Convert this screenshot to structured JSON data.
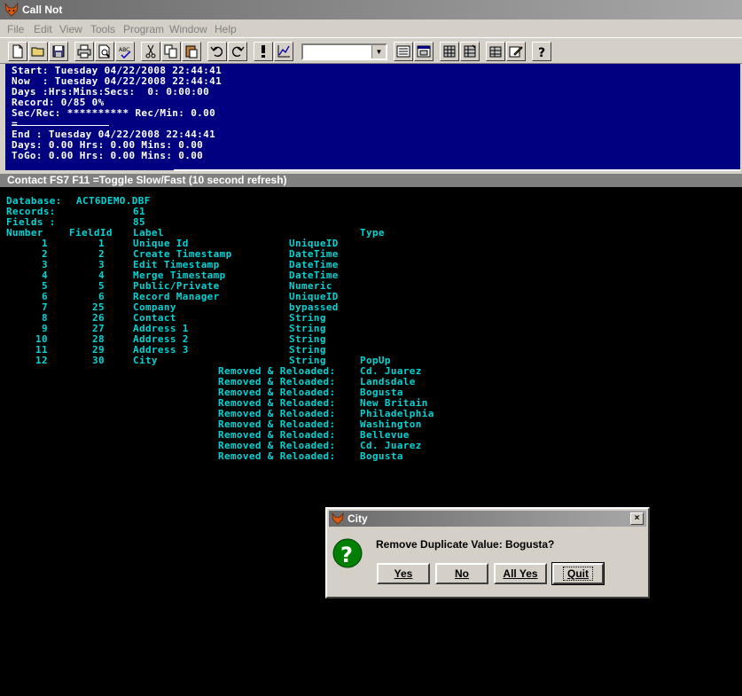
{
  "window": {
    "title": "Call Not"
  },
  "menu": [
    "File",
    "Edit",
    "View",
    "Tools",
    "Program",
    "Window",
    "Help"
  ],
  "toolbar": {
    "left_icons": [
      "new-file-icon",
      "open-folder-icon",
      "save-icon",
      "print-icon",
      "print-preview-icon",
      "spellcheck-icon",
      "cut-icon",
      "copy-icon",
      "paste-icon",
      "undo-icon",
      "redo-icon",
      "exclamation-icon",
      "chart-icon"
    ],
    "combo_value": "",
    "right_icons": [
      "form-icon",
      "window-icon",
      "grid-a-icon",
      "grid-b-icon",
      "grid-c-icon",
      "edit-note-icon",
      "help-icon"
    ]
  },
  "status_panel": {
    "lines": [
      "Start: Tuesday 04/22/2008 22:44:41",
      "Now  : Tuesday 04/22/2008 22:44:41",
      "Days :Hrs:Mins:Secs:  0: 0:00:00",
      "Record: 0/85 0%",
      "Sec/Rec: ********** Rec/Min: 0.00",
      "=",
      "End : Tuesday 04/22/2008 22:44:41",
      "Days: 0.00 Hrs: 0.00 Mins: 0.00",
      "ToGo: 0.00 Hrs: 0.00 Mins: 0.00"
    ]
  },
  "strip": {
    "text": "Contact FS7  F11 =Toggle Slow/Fast (10 second refresh)"
  },
  "console": {
    "database_label": "Database:",
    "database_value": "ACT6DEMO.DBF",
    "records_label": "Records:",
    "records_value": "61",
    "fields_label": "Fields :",
    "fields_value": "85",
    "headers": {
      "number": "Number",
      "fieldid": "FieldId",
      "label": "Label",
      "type": "Type"
    },
    "rows": [
      {
        "number": "1",
        "fieldid": "1",
        "label": "Unique Id",
        "type": "UniqueID",
        "extra": ""
      },
      {
        "number": "2",
        "fieldid": "2",
        "label": "Create Timestamp",
        "type": "DateTime",
        "extra": ""
      },
      {
        "number": "3",
        "fieldid": "3",
        "label": "Edit Timestamp",
        "type": "DateTime",
        "extra": ""
      },
      {
        "number": "4",
        "fieldid": "4",
        "label": "Merge Timestamp",
        "type": "DateTime",
        "extra": ""
      },
      {
        "number": "5",
        "fieldid": "5",
        "label": "Public/Private",
        "type": "Numeric",
        "extra": ""
      },
      {
        "number": "6",
        "fieldid": "6",
        "label": "Record Manager",
        "type": "UniqueID",
        "extra": ""
      },
      {
        "number": "7",
        "fieldid": "25",
        "label": "Company",
        "type": "bypassed",
        "extra": ""
      },
      {
        "number": "8",
        "fieldid": "26",
        "label": "Contact",
        "type": "String",
        "extra": ""
      },
      {
        "number": "9",
        "fieldid": "27",
        "label": "Address 1",
        "type": "String",
        "extra": ""
      },
      {
        "number": "10",
        "fieldid": "28",
        "label": "Address 2",
        "type": "String",
        "extra": ""
      },
      {
        "number": "11",
        "fieldid": "29",
        "label": "Address 3",
        "type": "String",
        "extra": ""
      },
      {
        "number": "12",
        "fieldid": "30",
        "label": "City",
        "type": "String",
        "extra": "PopUp"
      }
    ],
    "reload_prefix": "Removed & Reloaded:",
    "reloaded": [
      "Cd. Juarez",
      "Landsdale",
      "Bogusta",
      "New Britain",
      "Philadelphia",
      "Washington",
      "Bellevue",
      "Cd. Juarez",
      "Bogusta"
    ]
  },
  "dialog": {
    "title": "City",
    "close": "×",
    "message": "Remove Duplicate Value: Bogusta?",
    "buttons": {
      "yes": "Yes",
      "no": "No",
      "all_yes": "All Yes",
      "quit": "Quit"
    }
  },
  "colors": {
    "panel_blue": "#000080",
    "console_text": "#00d4d4",
    "console_bg": "#000000"
  }
}
